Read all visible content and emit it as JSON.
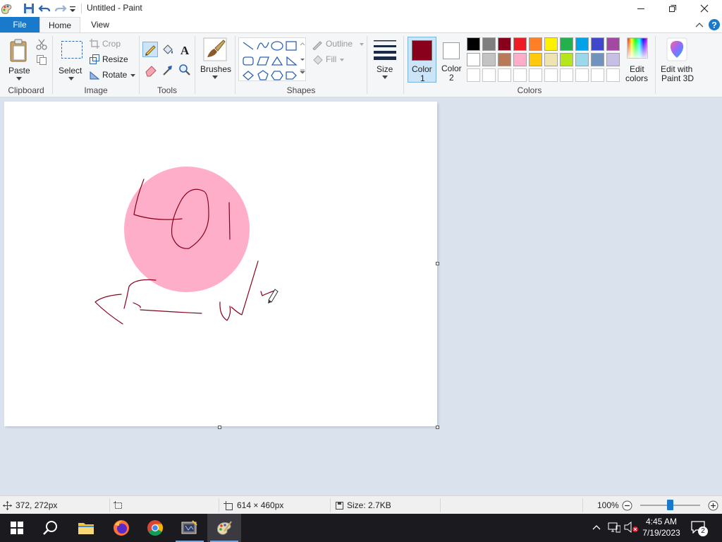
{
  "window": {
    "title": "Untitled - Paint"
  },
  "tabs": {
    "file": "File",
    "home": "Home",
    "view": "View"
  },
  "clipboard": {
    "paste": "Paste",
    "label": "Clipboard"
  },
  "image": {
    "select": "Select",
    "crop": "Crop",
    "resize": "Resize",
    "rotate": "Rotate",
    "label": "Image"
  },
  "tools": {
    "label": "Tools"
  },
  "brushes": {
    "label": "Brushes"
  },
  "shapes": {
    "outline": "Outline",
    "fill": "Fill",
    "label": "Shapes"
  },
  "size": {
    "label": "Size"
  },
  "colors": {
    "color1": "Color",
    "color1_num": "1",
    "color2": "Color",
    "color2_num": "2",
    "edit_line1": "Edit",
    "edit_line2": "colors",
    "label": "Colors",
    "active_color1": "#88001b",
    "row1": [
      "#000000",
      "#7f7f7f",
      "#88001b",
      "#ed1c24",
      "#ff7f27",
      "#fff200",
      "#22b14c",
      "#00a2e8",
      "#3f48cc",
      "#a349a4"
    ],
    "row2": [
      "#ffffff",
      "#c3c3c3",
      "#b97a57",
      "#ffaec9",
      "#ffc90e",
      "#efe4b0",
      "#b5e61d",
      "#99d9ea",
      "#7092be",
      "#c8bfe7"
    ]
  },
  "paint3d": {
    "line1": "Edit with",
    "line2": "Paint 3D"
  },
  "status": {
    "cursor": "372, 272px",
    "canvas_size": "614 × 460px",
    "file_size": "Size: 2.7KB",
    "zoom": "100%",
    "zoom_level": 0.5
  },
  "taskbar": {
    "time": "4:45 AM",
    "date": "7/19/2023",
    "notifications": "2"
  },
  "drawing": {
    "circle_color": "#ffaec9",
    "stroke_color": "#88001b"
  }
}
